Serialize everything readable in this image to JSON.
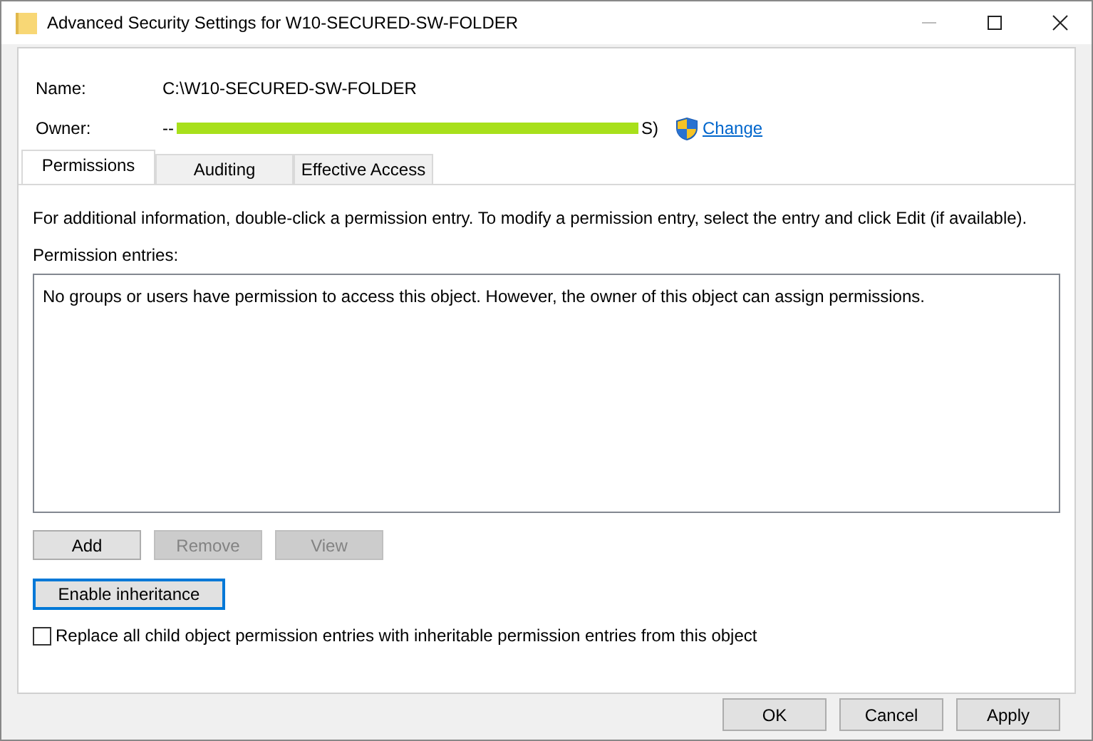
{
  "window": {
    "title": "Advanced Security Settings for W10-SECURED-SW-FOLDER"
  },
  "details": {
    "name_label": "Name:",
    "name_value": "C:\\W10-SECURED-SW-FOLDER",
    "owner_label": "Owner:",
    "owner_prefix": "--",
    "owner_suffix": "S)",
    "owner_redacted": true,
    "change_link": "Change"
  },
  "tabs": [
    {
      "label": "Permissions",
      "selected": true
    },
    {
      "label": "Auditing",
      "selected": false
    },
    {
      "label": "Effective Access",
      "selected": false
    }
  ],
  "info_text": "For additional information, double-click a permission entry. To modify a permission entry, select the entry and click Edit (if available).",
  "entries_label": "Permission entries:",
  "entries_message": "No groups or users have permission to access this object. However, the owner of this object can assign permissions.",
  "entry_buttons": [
    {
      "label": "Add",
      "disabled": false
    },
    {
      "label": "Remove",
      "disabled": true
    },
    {
      "label": "View",
      "disabled": true
    }
  ],
  "inheritance_button": {
    "label": "Enable inheritance",
    "focused": true
  },
  "replace_checkbox": {
    "label": "Replace all child object permission entries with inheritable permission entries from this object",
    "checked": false
  },
  "dialog_buttons": [
    {
      "label": "OK"
    },
    {
      "label": "Cancel"
    },
    {
      "label": "Apply"
    }
  ]
}
